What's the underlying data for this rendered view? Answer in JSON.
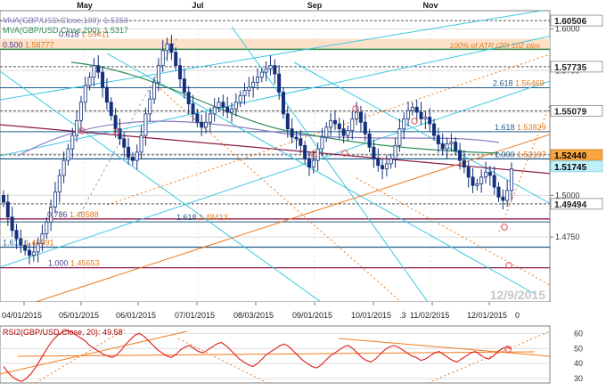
{
  "chart_data": [
    {
      "type": "candlestick",
      "title": "",
      "pair": "GBP/USD",
      "top_months": [
        "May",
        "Jul",
        "Sep",
        "Nov"
      ],
      "x_ticks": [
        "04/01/2015",
        "05/01/2015",
        "06/01/2015",
        "07/01/2015",
        "08/03/2015",
        "09/01/2015",
        "10/01/2015",
        "11/02/2015",
        "12/01/2015"
      ],
      "x_tick_fragments": [
        ".3",
        "0"
      ],
      "y_ticks": [
        1.6,
        1.575,
        1.55,
        1.525,
        1.5,
        1.475
      ],
      "ylim": [
        1.436,
        1.611
      ],
      "watermark": "12/9/2015",
      "legend": [
        {
          "label": "MVA(GBP/USD.Close,100)",
          "value": "1.5350",
          "color": "#8e7cc3"
        },
        {
          "label": "MVA(GBP/USD.Close,200)",
          "value": "1.5317",
          "color": "#2e8b57"
        }
      ],
      "price_badges": [
        {
          "label": "1.60506",
          "value": 1.60506,
          "style": "white"
        },
        {
          "label": "1.57735",
          "value": 1.57735,
          "style": "white"
        },
        {
          "label": "1.55079",
          "value": 1.55079,
          "style": "white"
        },
        {
          "label": "1.52440",
          "value": 1.5244,
          "style": "orange"
        },
        {
          "label": "1.51745",
          "value": 1.51745,
          "style": "cyan"
        },
        {
          "label": "1.49494",
          "value": 1.49494,
          "style": "white"
        }
      ],
      "level_labels": [
        {
          "ratio": "0.618",
          "value": "1.59411",
          "price": 1.59411,
          "color": "#4b3b8c"
        },
        {
          "ratio": "0.500",
          "value": "1.58777",
          "price": 1.58777,
          "color": "#4b3b8c"
        },
        {
          "ratio": "2.618",
          "value": "1.56469",
          "price": 1.56469,
          "color": "#1f5c8a"
        },
        {
          "ratio": "1.618",
          "value": "1.53829",
          "price": 1.53829,
          "color": "#1f5c8a"
        },
        {
          "ratio": "1.000",
          "value": "1.52197",
          "price": 1.52197,
          "color": "#1f5c8a"
        },
        {
          "ratio": "0.786",
          "value": "1.48588",
          "price": 1.48588,
          "color": "#4b3b8c"
        },
        {
          "ratio": "1.618",
          "value": "1.48413",
          "price": 1.48413,
          "color": "#1f5c8a"
        },
        {
          "ratio": "1.618",
          "value": "1.46891",
          "price": 1.46891,
          "color": "#1f5c8a"
        },
        {
          "ratio": "1.000",
          "value": "1.45653",
          "price": 1.45653,
          "color": "#4b3b8c"
        }
      ],
      "annotation": "100% of ATR (20) 102 pips",
      "series_close": [
        1.496,
        1.487,
        1.479,
        1.474,
        1.47,
        1.467,
        1.464,
        1.466,
        1.471,
        1.477,
        1.484,
        1.493,
        1.502,
        1.512,
        1.521,
        1.528,
        1.536,
        1.545,
        1.556,
        1.566,
        1.571,
        1.578,
        1.574,
        1.565,
        1.556,
        1.548,
        1.54,
        1.534,
        1.529,
        1.523,
        1.521,
        1.526,
        1.536,
        1.549,
        1.558,
        1.568,
        1.578,
        1.587,
        1.591,
        1.586,
        1.578,
        1.57,
        1.562,
        1.555,
        1.549,
        1.544,
        1.541,
        1.544,
        1.549,
        1.553,
        1.556,
        1.553,
        1.55,
        1.552,
        1.556,
        1.56,
        1.563,
        1.565,
        1.568,
        1.571,
        1.574,
        1.576,
        1.578,
        1.573,
        1.562,
        1.549,
        1.54,
        1.535,
        1.534,
        1.53,
        1.522,
        1.517,
        1.521,
        1.528,
        1.535,
        1.541,
        1.545,
        1.543,
        1.54,
        1.536,
        1.539,
        1.546,
        1.55,
        1.544,
        1.537,
        1.529,
        1.522,
        1.518,
        1.516,
        1.519,
        1.522,
        1.53,
        1.54,
        1.546,
        1.551,
        1.553,
        1.55,
        1.546,
        1.547,
        1.543,
        1.536,
        1.531,
        1.528,
        1.531,
        1.532,
        1.527,
        1.521,
        1.517,
        1.511,
        1.506,
        1.507,
        1.511,
        1.514,
        1.512,
        1.505,
        1.499,
        1.497,
        1.503,
        1.516
      ],
      "rsi": {
        "label": "RSI2(GBP/USD.Close, 20):",
        "value": "49.58",
        "ticks": [
          60,
          50,
          40,
          30
        ],
        "ylim": [
          27,
          65
        ],
        "values": [
          38,
          34,
          31,
          29,
          28,
          30,
          33,
          37,
          42,
          47,
          52,
          56,
          59,
          61,
          62,
          61,
          59,
          57,
          55,
          52,
          50,
          48,
          46,
          45,
          44,
          46,
          49,
          53,
          56,
          59,
          60,
          58,
          55,
          52,
          49,
          47,
          45,
          44,
          46,
          49,
          51,
          52,
          50,
          48,
          47,
          49,
          51,
          53,
          54,
          52,
          49,
          46,
          43,
          41,
          39,
          38,
          40,
          43,
          46,
          48,
          50,
          52,
          53,
          51,
          48,
          45,
          42,
          40,
          38,
          37,
          39,
          42,
          45,
          47,
          49,
          51,
          52,
          50,
          47,
          44,
          42,
          41,
          43,
          46,
          49,
          51,
          52,
          51,
          49,
          47,
          45,
          44,
          42,
          43,
          45,
          47,
          48,
          46,
          44,
          42,
          41,
          43,
          45,
          47,
          48,
          46,
          44,
          43,
          45,
          48,
          50,
          51,
          49.58
        ]
      }
    }
  ]
}
